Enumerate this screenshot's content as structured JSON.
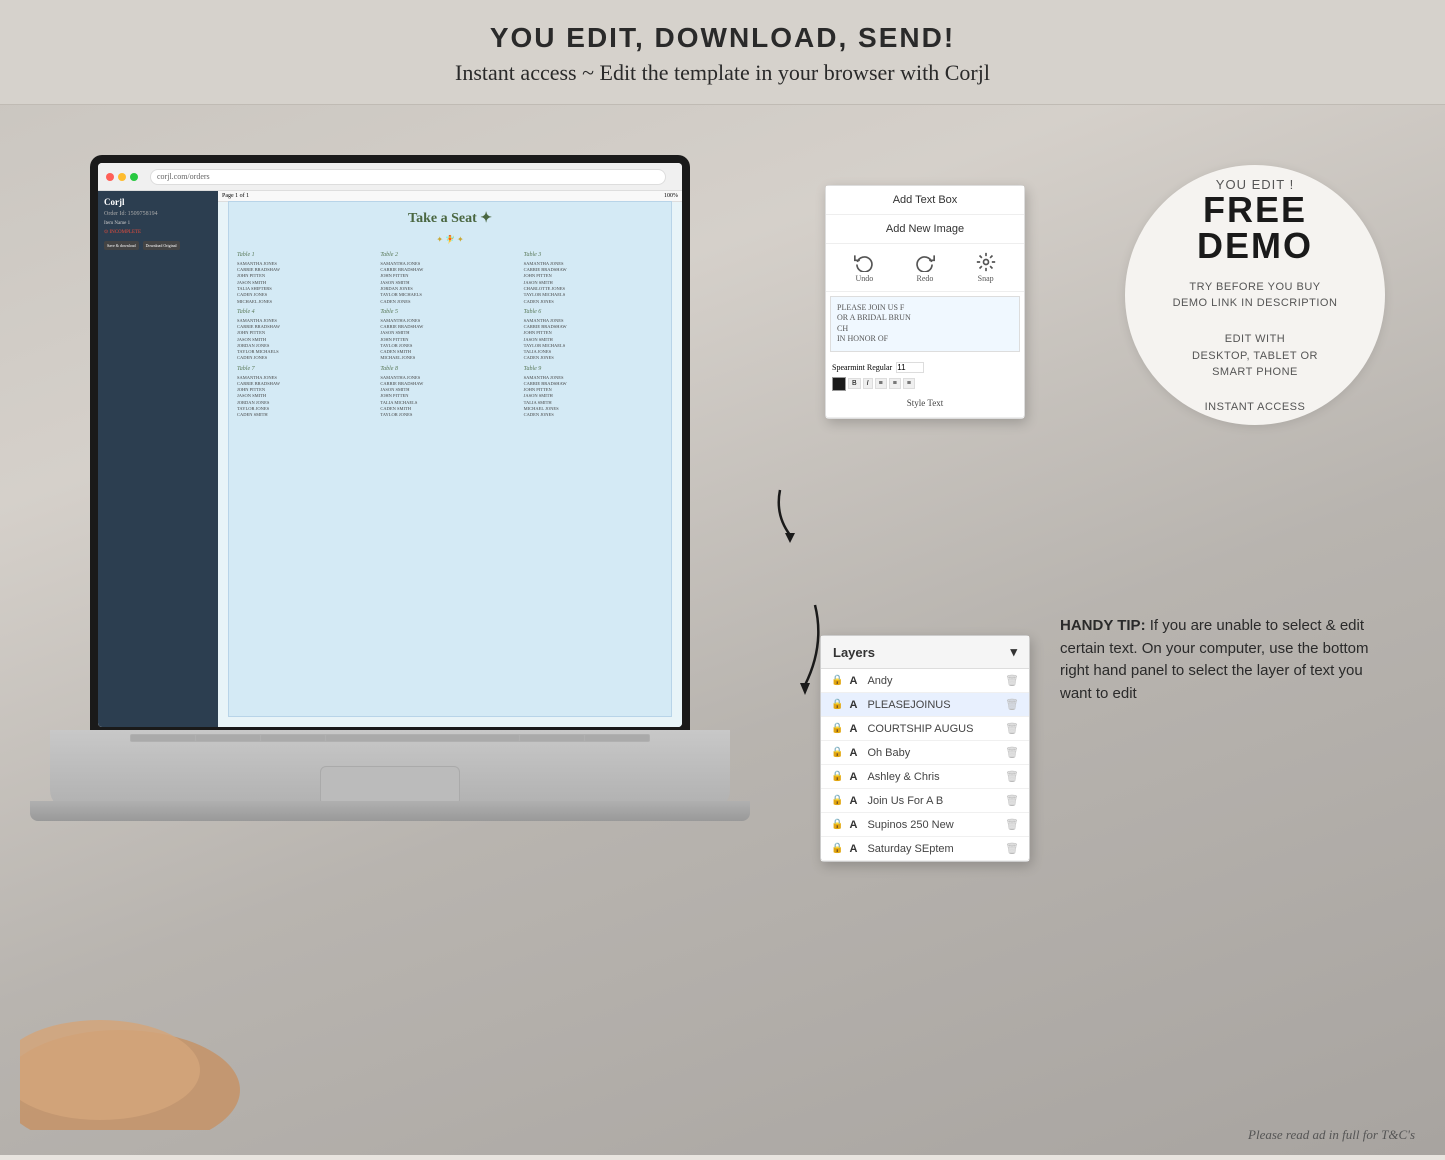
{
  "header": {
    "title": "YOU EDIT, DOWNLOAD, SEND!",
    "subtitle": "Instant access ~ Edit the template in your browser with Corjl"
  },
  "demo_circle": {
    "you_edit": "YOU EDIT !",
    "free": "FREE",
    "demo": "DEMO",
    "try_before": "TRY BEFORE YOU BUY",
    "demo_link": "DEMO LINK IN DESCRIPTION",
    "edit_with": "EDIT WITH",
    "platforms": "DESKTOP, TABLET OR",
    "smartphone": "SMART PHONE",
    "instant": "INSTANT ACCESS"
  },
  "corjl_panel": {
    "add_text_box": "Add Text Box",
    "add_new_image": "Add New Image",
    "undo": "Undo",
    "redo": "Redo",
    "snap": "Snap",
    "text_preview": "PLEASE JOIN US F\nOR A BRIDAL BRUN\nCH\nIN HONOR OF",
    "style_text": "Style Text"
  },
  "layers_panel": {
    "title": "Layers",
    "chevron": "▾",
    "items": [
      {
        "lock": "🔒",
        "type": "A",
        "name": "Andy",
        "delete": "🗑"
      },
      {
        "lock": "🔒",
        "type": "A",
        "name": "PLEASEJOINUS",
        "delete": "🗑",
        "active": true
      },
      {
        "lock": "🔒",
        "type": "A",
        "name": "COURTSHIP AUGUS",
        "delete": "🗑"
      },
      {
        "lock": "🔒",
        "type": "A",
        "name": "Oh Baby",
        "delete": "🗑"
      },
      {
        "lock": "🔒",
        "type": "A",
        "name": "Ashley & Chris",
        "delete": "🗑"
      },
      {
        "lock": "🔒",
        "type": "A",
        "name": "Join Us For A B",
        "delete": "🗑"
      },
      {
        "lock": "🔒",
        "type": "A",
        "name": "Supinos 250 New",
        "delete": "🗑"
      },
      {
        "lock": "🔒",
        "type": "A",
        "name": "Saturday SEptem",
        "delete": "🗑"
      }
    ]
  },
  "handy_tip": {
    "bold": "HANDY TIP:",
    "text": " If you are unable to select & edit certain text. On your computer, use the bottom right hand panel to select the layer of text you want to edit"
  },
  "bottom_note": {
    "text": "Please read ad in full for T&C's"
  },
  "seating_chart": {
    "title": "Take a Seat",
    "tables": [
      {
        "label": "Table 1",
        "names": [
          "SAMANTHA JONES",
          "CARRIE BRADSHAW",
          "JOHN PITTEN",
          "JASON SMITH",
          "TALIA SHIFTERS",
          "CADEN JONES",
          "MICHAEL JONES"
        ]
      },
      {
        "label": "Table 2",
        "names": [
          "SAMANTHA JONES",
          "CARRIE BRADSHAW",
          "JOHN PITTEN",
          "JASON SMITH",
          "JORDAN JONES",
          "TAYLOR MICHAELS",
          "CADEN JONES"
        ]
      },
      {
        "label": "Table 3",
        "names": [
          "SAMANTHA JONES",
          "CARRIE BRADSHAW",
          "JOHN PITTEN",
          "JASON SMITH",
          "CHARLOTTE JONES",
          "TAYLOR MICHAELS",
          "CADEN JONES"
        ]
      },
      {
        "label": "Table 4",
        "names": [
          "SAMANTHA JONES",
          "CARRIE BRADSHAW",
          "JOHN PITTEN",
          "JASON SMITH",
          "JORDAN JONES",
          "TAYLOR MICHAELS",
          "CADEN JONES"
        ]
      },
      {
        "label": "Table 5",
        "names": [
          "SAMANTHA JONES",
          "CARRIE BRADSHAW",
          "JASON SMITH",
          "JOHN PITTEN",
          "TAYLOR JONES",
          "CADEN SMITH",
          "MICHAEL JONES"
        ]
      },
      {
        "label": "Table 6",
        "names": [
          "SAMANTHA JONES",
          "CARRIE BRADSHAW",
          "JOHN PITTEN",
          "JASON SMITH",
          "TAYLOR MICHAELS",
          "TALIA JONES",
          "CADEN JONES"
        ]
      },
      {
        "label": "Table 7",
        "names": [
          "SAMANTHA JONES",
          "CARRIE BRADSHAW",
          "JOHN PITTEN",
          "JASON SMITH",
          "JORDAN JONES",
          "TAYLOR JONES",
          "CADEN SMITH"
        ]
      },
      {
        "label": "Table 8",
        "names": [
          "SAMANTHA JONES",
          "CARRIE BRADSHAW",
          "JASON SMITH",
          "JOHN PITTEN",
          "TALIA MICHAELS",
          "CADEN SMITH",
          "TAYLOR JONES"
        ]
      },
      {
        "label": "Table 9",
        "names": [
          "SAMANTHA JONES",
          "CARRIE BRADSHAW",
          "JOHN PITTEN",
          "JASON SMITH",
          "TALIA SMITH",
          "MICHAEL JONES",
          "CADEN JONES"
        ]
      }
    ]
  }
}
